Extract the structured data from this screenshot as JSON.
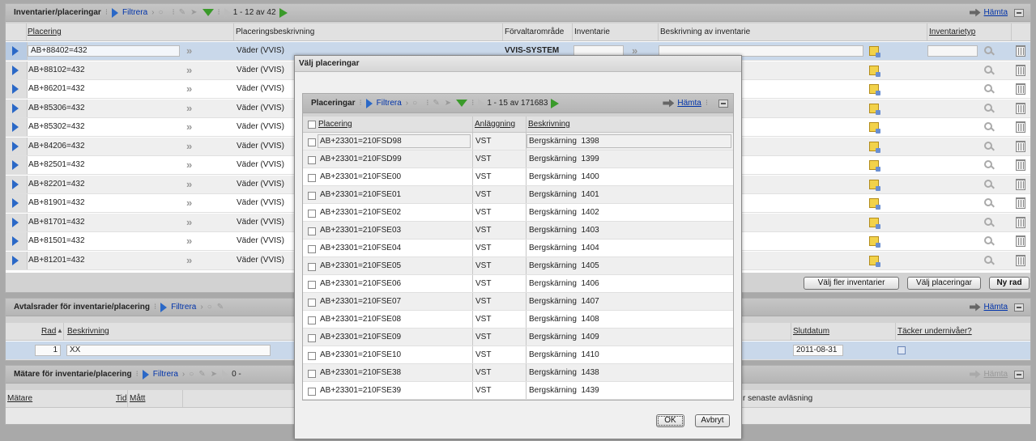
{
  "main": {
    "title": "Inventarier/placeringar",
    "filter_label": "Filtrera",
    "paging": "1 - 12 av 42",
    "fetch_label": "Hämta",
    "columns": {
      "placering": "Placering",
      "placeringsbeskrivning": "Placeringsbeskrivning",
      "forvaltomrade": "Förvaltarområde",
      "inventarie": "Inventarie",
      "beskrivning_inventarie": "Beskrivning av inventarie",
      "inventarietyp": "Inventarietyp"
    },
    "rows": [
      {
        "placering": "AB+88402=432",
        "beskrivning": "Väder  (VVIS)",
        "forvalt": "VVIS-SYSTEM"
      },
      {
        "placering": "AB+88102=432",
        "beskrivning": "Väder  (VVIS)",
        "forvalt": ""
      },
      {
        "placering": "AB+86201=432",
        "beskrivning": "Väder  (VVIS)",
        "forvalt": ""
      },
      {
        "placering": "AB+85306=432",
        "beskrivning": "Väder  (VVIS)",
        "forvalt": ""
      },
      {
        "placering": "AB+85302=432",
        "beskrivning": "Väder  (VVIS)",
        "forvalt": ""
      },
      {
        "placering": "AB+84206=432",
        "beskrivning": "Väder  (VVIS)",
        "forvalt": ""
      },
      {
        "placering": "AB+82501=432",
        "beskrivning": "Väder  (VVIS)",
        "forvalt": ""
      },
      {
        "placering": "AB+82201=432",
        "beskrivning": "Väder  (VVIS)",
        "forvalt": ""
      },
      {
        "placering": "AB+81901=432",
        "beskrivning": "Väder  (VVIS)",
        "forvalt": ""
      },
      {
        "placering": "AB+81701=432",
        "beskrivning": "Väder  (VVIS)",
        "forvalt": ""
      },
      {
        "placering": "AB+81501=432",
        "beskrivning": "Väder  (VVIS)",
        "forvalt": ""
      },
      {
        "placering": "AB+81201=432",
        "beskrivning": "Väder  (VVIS)",
        "forvalt": ""
      }
    ],
    "buttons": {
      "valj_fler": "Välj fler inventarier",
      "valj_placeringar": "Välj placeringar",
      "ny_rad": "Ny rad"
    }
  },
  "avtal": {
    "title": "Avtalsrader för inventarie/placering",
    "filter_label": "Filtrera",
    "fetch_label": "Hämta",
    "columns": {
      "rad": "Rad",
      "beskrivning": "Beskrivning",
      "slutdatum": "Slutdatum",
      "tacker": "Täcker undernivåer?"
    },
    "row": {
      "rad": "1",
      "beskrivning": "XX",
      "slutdatum": "2011-08-31"
    }
  },
  "matare": {
    "title": "Mätare för inventarie/placering",
    "filter_label": "Filtrera",
    "paging": "0 -",
    "fetch_label": "Hämta",
    "columns": {
      "matare": "Mätare",
      "tid": "Tid",
      "matt": "Mått",
      "senaste": "r senaste avläsning"
    }
  },
  "dialog": {
    "title": "Välj placeringar",
    "grid_title": "Placeringar",
    "filter_label": "Filtrera",
    "paging": "1 - 15 av 171683",
    "fetch_label": "Hämta",
    "columns": {
      "placering": "Placering",
      "anlaggning": "Anläggning",
      "beskrivning": "Beskrivning"
    },
    "rows": [
      {
        "placering": "AB+23301=210FSD98",
        "anl": "VST",
        "besk": "Bergskärning  1398"
      },
      {
        "placering": "AB+23301=210FSD99",
        "anl": "VST",
        "besk": "Bergskärning  1399"
      },
      {
        "placering": "AB+23301=210FSE00",
        "anl": "VST",
        "besk": "Bergskärning  1400"
      },
      {
        "placering": "AB+23301=210FSE01",
        "anl": "VST",
        "besk": "Bergskärning  1401"
      },
      {
        "placering": "AB+23301=210FSE02",
        "anl": "VST",
        "besk": "Bergskärning  1402"
      },
      {
        "placering": "AB+23301=210FSE03",
        "anl": "VST",
        "besk": "Bergskärning  1403"
      },
      {
        "placering": "AB+23301=210FSE04",
        "anl": "VST",
        "besk": "Bergskärning  1404"
      },
      {
        "placering": "AB+23301=210FSE05",
        "anl": "VST",
        "besk": "Bergskärning  1405"
      },
      {
        "placering": "AB+23301=210FSE06",
        "anl": "VST",
        "besk": "Bergskärning  1406"
      },
      {
        "placering": "AB+23301=210FSE07",
        "anl": "VST",
        "besk": "Bergskärning  1407"
      },
      {
        "placering": "AB+23301=210FSE08",
        "anl": "VST",
        "besk": "Bergskärning  1408"
      },
      {
        "placering": "AB+23301=210FSE09",
        "anl": "VST",
        "besk": "Bergskärning  1409"
      },
      {
        "placering": "AB+23301=210FSE10",
        "anl": "VST",
        "besk": "Bergskärning  1410"
      },
      {
        "placering": "AB+23301=210FSE38",
        "anl": "VST",
        "besk": "Bergskärning  1438"
      },
      {
        "placering": "AB+23301=210FSE39",
        "anl": "VST",
        "besk": "Bergskärning  1439"
      }
    ],
    "ok_label": "OK",
    "cancel_label": "Avbryt"
  }
}
